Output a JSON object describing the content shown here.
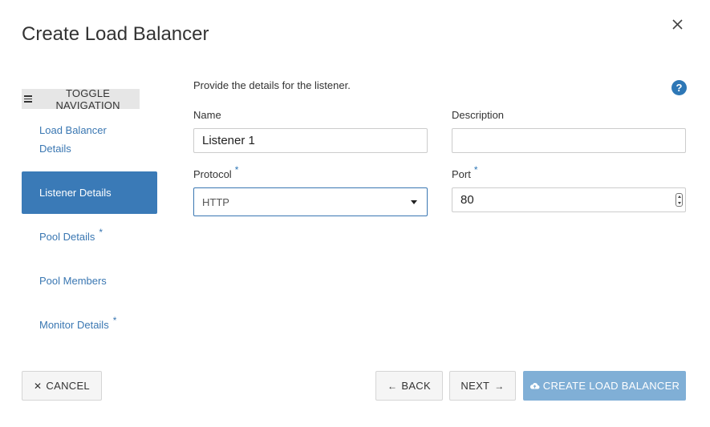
{
  "modal": {
    "title": "Create Load Balancer",
    "close_icon": "close-icon"
  },
  "sidebar": {
    "toggle_label": "TOGGLE NAVIGATION",
    "items": [
      {
        "label": "Load Balancer Details",
        "label_line1": "Load Balancer",
        "label_line2": "Details",
        "required": false,
        "active": false
      },
      {
        "label": "Listener Details",
        "required": false,
        "active": true
      },
      {
        "label": "Pool Details",
        "required": true,
        "active": false
      },
      {
        "label": "Pool Members",
        "required": false,
        "active": false
      },
      {
        "label": "Monitor Details",
        "required": true,
        "active": false
      }
    ],
    "required_marker": "*"
  },
  "form": {
    "intro": "Provide the details for the listener.",
    "help_icon": "?",
    "name_label": "Name",
    "name_value": "Listener 1",
    "description_label": "Description",
    "description_value": "",
    "protocol_label": "Protocol",
    "protocol_value": "HTTP",
    "port_label": "Port",
    "port_value": "80",
    "required_marker": "*"
  },
  "footer": {
    "cancel_label": "CANCEL",
    "back_label": "BACK",
    "next_label": "NEXT",
    "create_label": "CREATE LOAD BALANCER"
  },
  "colors": {
    "accent": "#3a7ab7",
    "primary_disabled": "#80afd6",
    "link": "#3a77b2"
  }
}
